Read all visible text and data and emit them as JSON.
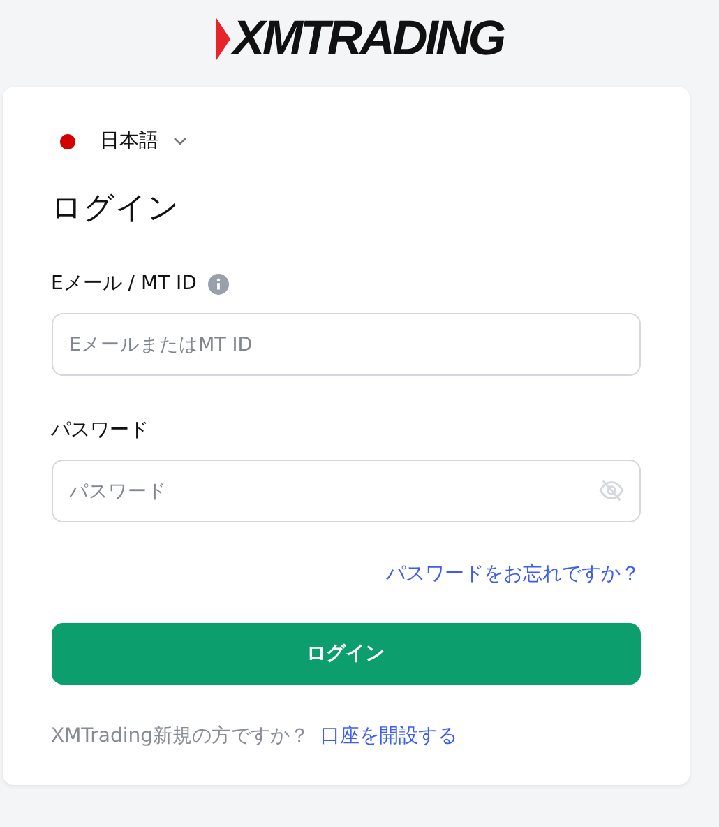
{
  "logo": {
    "text": "XMTRADING"
  },
  "language": {
    "label": "日本語",
    "color": "#d50000"
  },
  "title": "ログイン",
  "fields": [
    {
      "label": "Eメール / MT ID",
      "info": true,
      "placeholder": "EメールまたはMT ID",
      "kind": "text"
    },
    {
      "label": "パスワード",
      "info": false,
      "placeholder": "パスワード",
      "kind": "password"
    }
  ],
  "forgot_link": "パスワードをお忘れですか？",
  "login_button": "ログイン",
  "footer": {
    "text": "XMTrading新規の方ですか？",
    "link": "口座を開設する"
  }
}
